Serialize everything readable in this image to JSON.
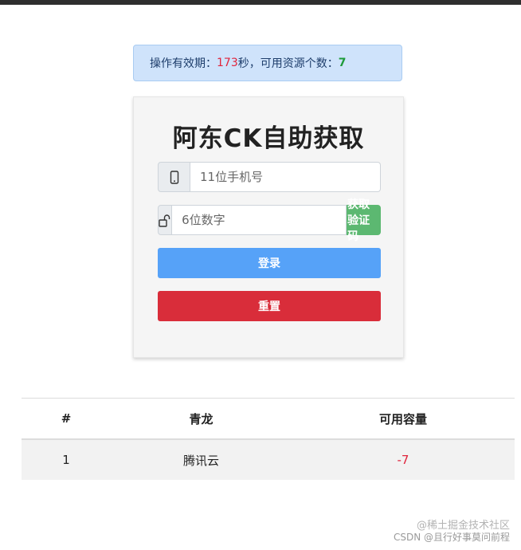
{
  "alert": {
    "prefix": "操作有效期：",
    "seconds": "173",
    "middle": "秒，可用资源个数：",
    "count": "7"
  },
  "card": {
    "title": "阿东CK自助获取",
    "phone_placeholder": "11位手机号",
    "code_placeholder": "6位数字",
    "get_code_label": "获取验证码",
    "login_label": "登录",
    "reset_label": "重置",
    "icons": {
      "phone": "mobile-phone-icon",
      "lock": "unlock-icon"
    }
  },
  "table": {
    "headers": [
      "#",
      "青龙",
      "可用容量"
    ],
    "rows": [
      {
        "index": "1",
        "name": "腾讯云",
        "capacity": "-7"
      }
    ]
  },
  "watermark": {
    "line1": "@稀土掘金技术社区",
    "line2": "CSDN @且行好事莫问前程"
  },
  "colors": {
    "alert_bg": "#cfe3fb",
    "code_button": "#5cb871",
    "login_button": "#56a2f8",
    "reset_button": "#d92d3a",
    "negative": "#e0243c",
    "positive": "#1e9b3a"
  }
}
